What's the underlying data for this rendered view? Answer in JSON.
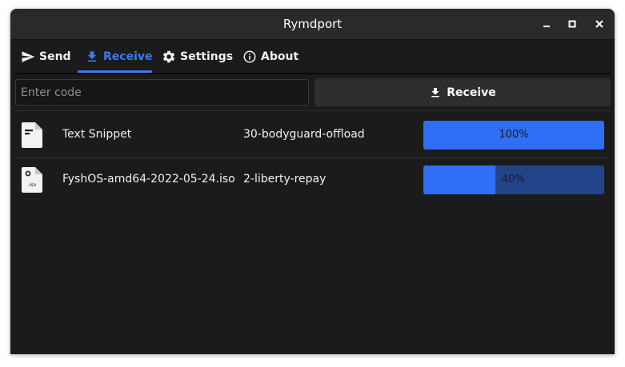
{
  "window": {
    "title": "Rymdport",
    "controls": [
      "minimize-icon",
      "maximize-icon",
      "close-icon"
    ]
  },
  "tabs": [
    {
      "label": "Send",
      "icon": "send-icon",
      "active": false
    },
    {
      "label": "Receive",
      "icon": "download-icon",
      "active": true
    },
    {
      "label": "Settings",
      "icon": "gear-icon",
      "active": false
    },
    {
      "label": "About",
      "icon": "info-icon",
      "active": false
    }
  ],
  "receive_form": {
    "code_placeholder": "Enter code",
    "code_value": "",
    "button_label": "Receive",
    "button_icon": "download-icon"
  },
  "transfers": [
    {
      "icon": "text-file-icon",
      "name": "Text Snippet",
      "code": "30-bodyguard-offload",
      "progress": 1.0,
      "progress_label": "100%"
    },
    {
      "icon": "iso-file-icon",
      "icon_label": ".iso",
      "name": "FyshOS-amd64-2022-05-24.iso",
      "code": "2-liberty-repay",
      "progress": 0.4,
      "progress_label": "40%"
    }
  ],
  "colors": {
    "accent": "#3c7bf0",
    "progress_fill": "#2f6ff5",
    "progress_track": "#24448a",
    "background": "#1b1b1b",
    "titlebar": "#2a2a2a"
  }
}
